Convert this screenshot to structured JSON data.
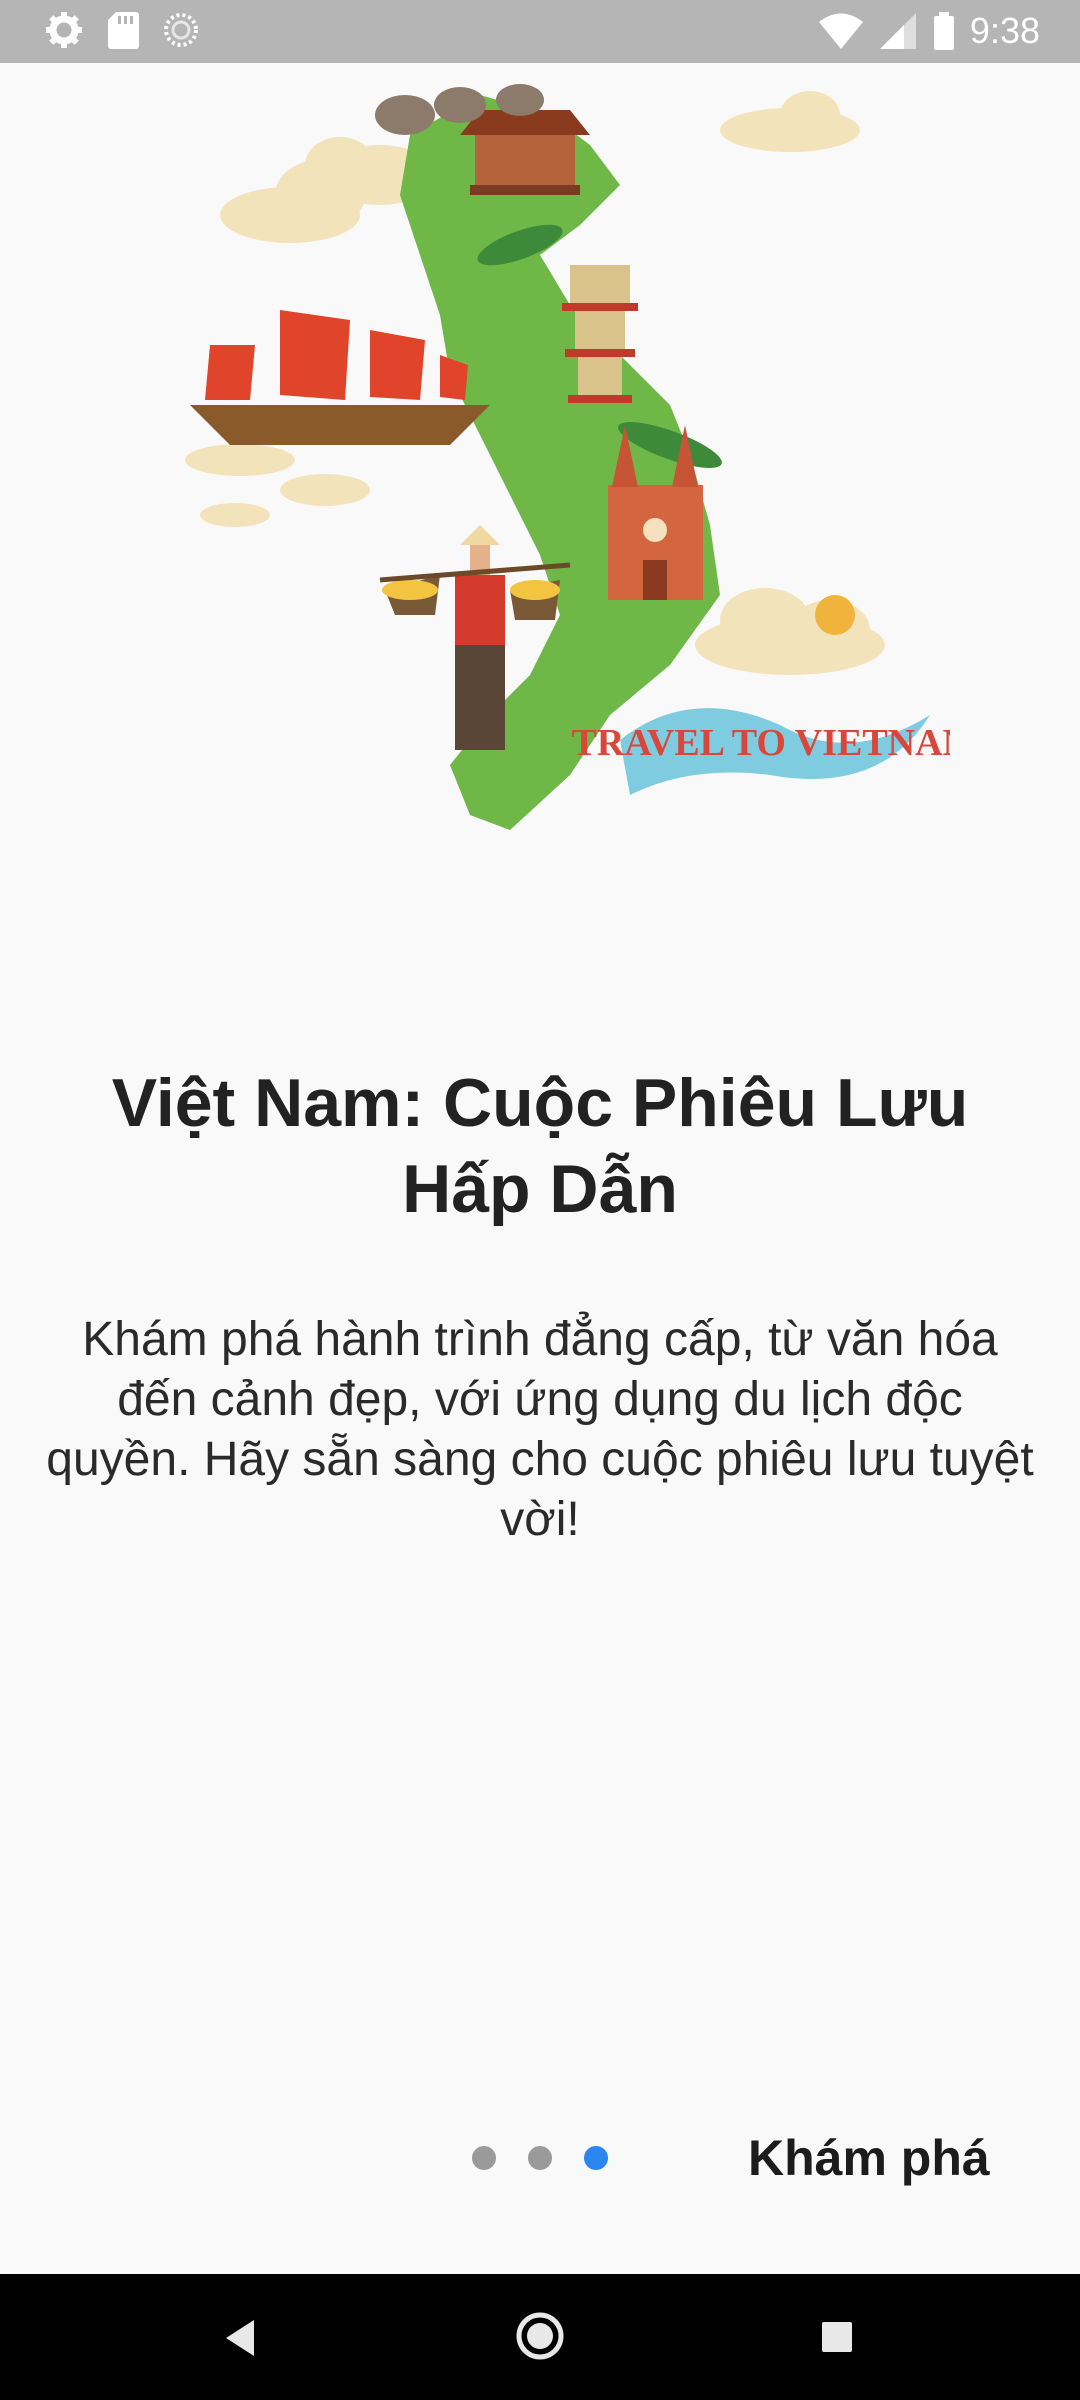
{
  "status_bar": {
    "time": "9:38",
    "left_icons": [
      "gear-icon",
      "sd-card-icon",
      "loading-icon"
    ],
    "right_icons": [
      "wifi-icon",
      "signal-icon",
      "battery-icon"
    ]
  },
  "hero": {
    "illustration": "vietnam-travel-map-illustration",
    "banner_text": "TRAVEL TO VIETNAM"
  },
  "onboarding": {
    "title": "Việt Nam: Cuộc Phiêu Lưu Hấp Dẫn",
    "description": "Khám phá hành trình đẳng cấp, từ văn hóa đến cảnh đẹp, với ứng dụng du lịch độc quyền. Hãy sẵn sàng cho cuộc phiêu lưu tuyệt vời!",
    "page_count": 3,
    "current_page": 3,
    "cta_label": "Khám phá"
  },
  "colors": {
    "background": "#f9f9f9",
    "active_dot": "#2b86f0",
    "inactive_dot": "#9a9a9a",
    "status_bar": "#b5b5b5",
    "nav_bar": "#000000"
  },
  "nav_bar": {
    "buttons": [
      "back-icon",
      "home-icon",
      "recents-icon"
    ]
  }
}
